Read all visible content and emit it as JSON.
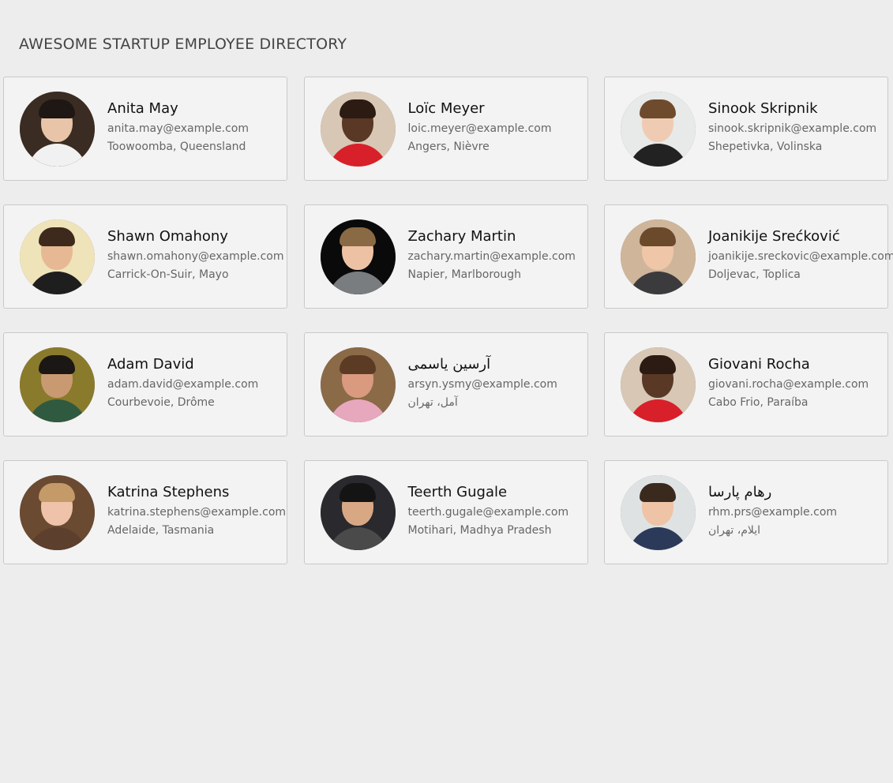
{
  "header": {
    "title": "AWESOME STARTUP EMPLOYEE DIRECTORY"
  },
  "employees": [
    {
      "name": "Anita May",
      "email": "anita.may@example.com",
      "location": "Toowoomba, Queensland",
      "colors": {
        "bg": "#3a2c22",
        "skin": "#e8c4a8",
        "hair": "#1f1713",
        "shirt": "#f1f1f1"
      }
    },
    {
      "name": "Loïc Meyer",
      "email": "loic.meyer@example.com",
      "location": "Angers, Nièvre",
      "colors": {
        "bg": "#d8c7b5",
        "skin": "#5a3826",
        "hair": "#2c1b12",
        "shirt": "#d8202a"
      }
    },
    {
      "name": "Sinook Skripnik",
      "email": "sinook.skripnik@example.com",
      "location": "Shepetivka, Volinska",
      "colors": {
        "bg": "#e7eae8",
        "skin": "#f0cbb4",
        "hair": "#6f4b2d",
        "shirt": "#222222"
      }
    },
    {
      "name": "Shawn Omahony",
      "email": "shawn.omahony@example.com",
      "location": "Carrick-On-Suir, Mayo",
      "colors": {
        "bg": "#efe3b9",
        "skin": "#e6b994",
        "hair": "#3e2a1c",
        "shirt": "#1e1e1e"
      }
    },
    {
      "name": "Zachary Martin",
      "email": "zachary.martin@example.com",
      "location": "Napier, Marlborough",
      "colors": {
        "bg": "#0a0a0a",
        "skin": "#edc2a4",
        "hair": "#8a6a44",
        "shirt": "#7a7d7f"
      }
    },
    {
      "name": "Joanikije Srećković",
      "email": "joanikije.sreckovic@example.com",
      "location": "Doljevac, Toplica",
      "colors": {
        "bg": "#cfb59a",
        "skin": "#efc6a8",
        "hair": "#6b4a2c",
        "shirt": "#3b3b3d"
      }
    },
    {
      "name": "Adam David",
      "email": "adam.david@example.com",
      "location": "Courbevoie, Drôme",
      "colors": {
        "bg": "#8a7a2c",
        "skin": "#c99a72",
        "hair": "#1b1714",
        "shirt": "#2f5a3f"
      }
    },
    {
      "name": "آرسین یاسمی",
      "email": "arsyn.ysmy@example.com",
      "location": "آمل، تهران",
      "colors": {
        "bg": "#8b6a48",
        "skin": "#d99a80",
        "hair": "#5b3b24",
        "shirt": "#e7a7bd"
      }
    },
    {
      "name": "Giovani Rocha",
      "email": "giovani.rocha@example.com",
      "location": "Cabo Frio, Paraíba",
      "colors": {
        "bg": "#d8c7b5",
        "skin": "#5a3826",
        "hair": "#2c1b12",
        "shirt": "#d8202a"
      }
    },
    {
      "name": "Katrina Stephens",
      "email": "katrina.stephens@example.com",
      "location": "Adelaide, Tasmania",
      "colors": {
        "bg": "#6b4a32",
        "skin": "#eec3a9",
        "hair": "#c49a68",
        "shirt": "#5c3f2c"
      }
    },
    {
      "name": "Teerth Gugale",
      "email": "teerth.gugale@example.com",
      "location": "Motihari, Madhya Pradesh",
      "colors": {
        "bg": "#2a2a2e",
        "skin": "#d8a885",
        "hair": "#141414",
        "shirt": "#4a4a4a"
      }
    },
    {
      "name": "رهام پارسا",
      "email": "rhm.prs@example.com",
      "location": "ایلام، تهران",
      "colors": {
        "bg": "#dfe2e3",
        "skin": "#efc3a5",
        "hair": "#3a2a1e",
        "shirt": "#2c3a5a"
      }
    }
  ]
}
